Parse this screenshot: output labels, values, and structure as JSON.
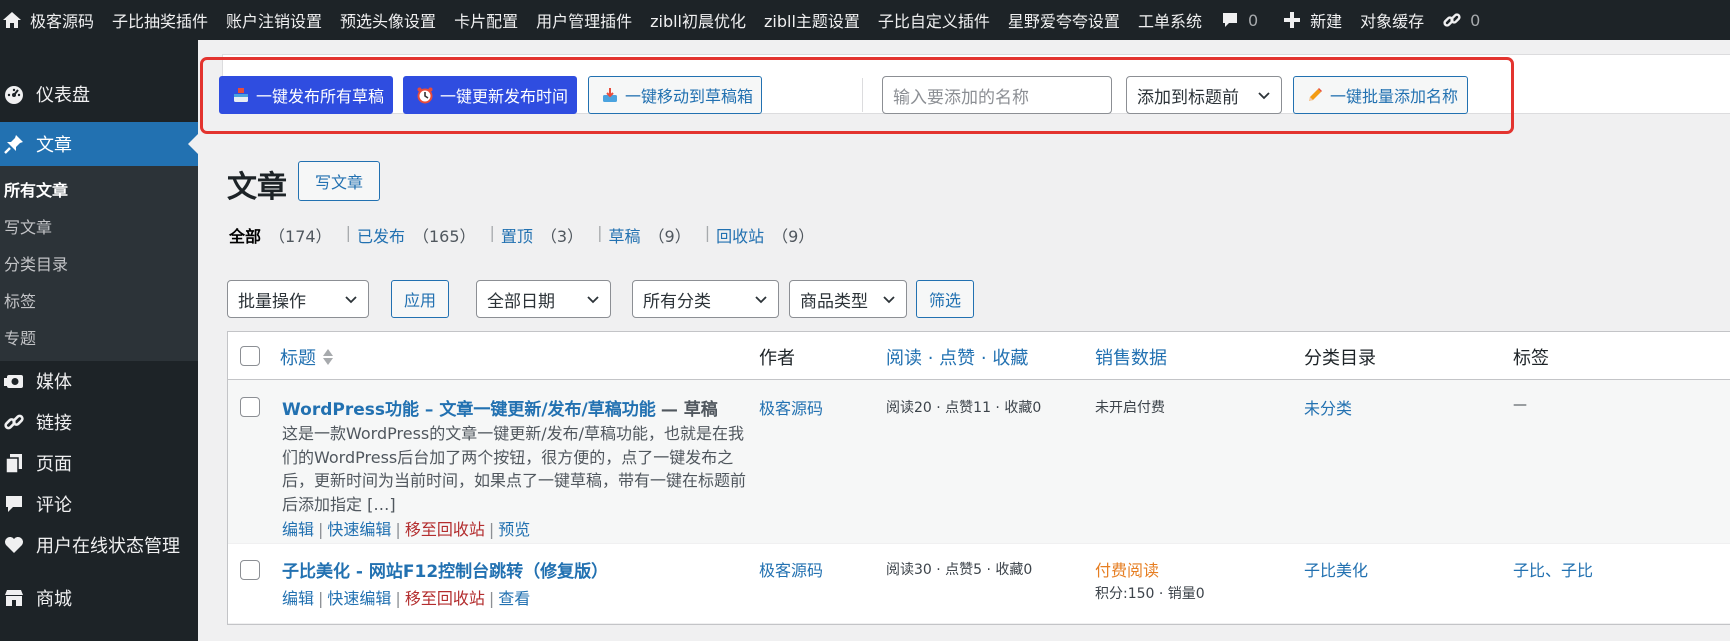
{
  "adminbar": {
    "items": [
      {
        "label": "极客源码",
        "icon": "home-icon"
      },
      {
        "label": "子比抽奖插件"
      },
      {
        "label": "账户注销设置"
      },
      {
        "label": "预选头像设置"
      },
      {
        "label": "卡片配置"
      },
      {
        "label": "用户管理插件"
      },
      {
        "label": "zibll初晨优化"
      },
      {
        "label": "zibll主题设置"
      },
      {
        "label": "子比自定义插件"
      },
      {
        "label": "星野爱夸夸设置"
      },
      {
        "label": "工单系统"
      }
    ],
    "comments_count": "0",
    "new_label": "新建",
    "cache_label": "对象缓存",
    "links_count": "0"
  },
  "sidebar": {
    "dashboard": "仪表盘",
    "posts": "文章",
    "posts_sub": [
      "所有文章",
      "写文章",
      "分类目录",
      "标签",
      "专题"
    ],
    "media": "媒体",
    "links": "链接",
    "pages": "页面",
    "comments": "评论",
    "online_status": "用户在线状态管理",
    "shop": "商城"
  },
  "toolbar": {
    "publish_all_drafts": "一键发布所有草稿",
    "update_publish_time": "一键更新发布时间",
    "move_to_drafts": "一键移动到草稿箱",
    "name_placeholder": "输入要添加的名称",
    "position_select": "添加到标题前",
    "batch_add_name": "一键批量添加名称",
    "accent_color": "#2f4de0",
    "highlight_color": "#e3342f"
  },
  "page": {
    "title": "文章",
    "add_new": "写文章"
  },
  "views": [
    {
      "label": "全部",
      "count": "（174）"
    },
    {
      "label": "已发布",
      "count": "（165）"
    },
    {
      "label": "置顶",
      "count": "（3）"
    },
    {
      "label": "草稿",
      "count": "（9）"
    },
    {
      "label": "回收站",
      "count": "（9）"
    }
  ],
  "filters": {
    "bulk_actions": "批量操作",
    "apply": "应用",
    "all_dates": "全部日期",
    "all_categories": "所有分类",
    "product_type": "商品类型",
    "filter": "筛选"
  },
  "table": {
    "headers": {
      "title": "标题",
      "author": "作者",
      "stats": "阅读 · 点赞 · 收藏",
      "sales": "销售数据",
      "categories": "分类目录",
      "tags": "标签"
    },
    "rows": [
      {
        "title": "WordPress功能 – 文章一键更新/发布/草稿功能",
        "state": "— 草稿",
        "excerpt": "这是一款WordPress的文章一键更新/发布/草稿功能，也就是在我们的WordPress后台加了两个按钮，很方便的，点了一键发布之后，更新时间为当前时间，如果点了一键草稿，带有一键在标题前后添加指定 […]",
        "actions": {
          "edit": "编辑",
          "quick_edit": "快速编辑",
          "trash": "移至回收站",
          "view": "预览"
        },
        "author": "极客源码",
        "stats": "阅读20 · 点赞11 · 收藏0",
        "sales": "未开启付费",
        "sales_extra": "",
        "category": "未分类",
        "tags": "—"
      },
      {
        "title": "子比美化 - 网站F12控制台跳转（修复版）",
        "state": "",
        "excerpt": "",
        "actions": {
          "edit": "编辑",
          "quick_edit": "快速编辑",
          "trash": "移至回收站",
          "view": "查看"
        },
        "author": "极客源码",
        "stats": "阅读30 · 点赞5 · 收藏0",
        "sales": "付费阅读",
        "sales_extra": "积分:150 · 销量0",
        "category": "子比美化",
        "tags": "子比、子比"
      }
    ]
  }
}
